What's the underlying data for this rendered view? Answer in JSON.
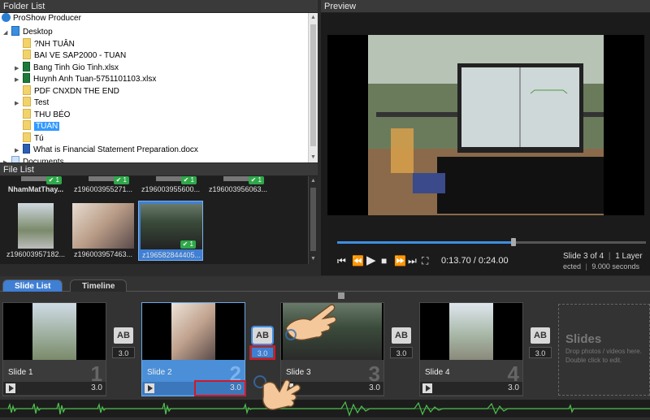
{
  "folder_list": {
    "title": "Folder List",
    "root": "ProShow Producer",
    "items": [
      {
        "label": "Desktop",
        "type": "desktop",
        "indent": 1,
        "arrow": "expanded"
      },
      {
        "label": "?NH TUÂN",
        "type": "folder",
        "indent": 2,
        "arrow": ""
      },
      {
        "label": "BAI VE SAP2000 - TUAN",
        "type": "folder",
        "indent": 2,
        "arrow": ""
      },
      {
        "label": "Bang Tinh Gio Tinh.xlsx",
        "type": "xls",
        "indent": 2,
        "arrow": "collapsed"
      },
      {
        "label": "Huynh Anh Tuan-5751101103.xlsx",
        "type": "xls",
        "indent": 2,
        "arrow": "collapsed"
      },
      {
        "label": "PDF CNXDN THE END",
        "type": "pdf",
        "indent": 2,
        "arrow": ""
      },
      {
        "label": "Test",
        "type": "folder",
        "indent": 2,
        "arrow": "collapsed"
      },
      {
        "label": "THU BÉO",
        "type": "folder",
        "indent": 2,
        "arrow": ""
      },
      {
        "label": "TUAN",
        "type": "folder",
        "indent": 2,
        "arrow": "",
        "selected": true
      },
      {
        "label": "Tú",
        "type": "folder",
        "indent": 2,
        "arrow": ""
      },
      {
        "label": "What is Financial Statement Preparation.docx",
        "type": "doc",
        "indent": 2,
        "arrow": "collapsed"
      },
      {
        "label": "Documents",
        "type": "docs",
        "indent": 1,
        "arrow": "collapsed"
      }
    ]
  },
  "file_list": {
    "title": "File List",
    "row1": [
      {
        "name": "NhamMatThay...",
        "checked": true,
        "count": "1"
      },
      {
        "name": "z196003955271...",
        "checked": true,
        "count": "1"
      },
      {
        "name": "z196003955600...",
        "checked": true,
        "count": "1"
      },
      {
        "name": "z196003956063...",
        "checked": true,
        "count": "1"
      }
    ],
    "row2": [
      {
        "name": "z196003957182...",
        "checked": false,
        "count": ""
      },
      {
        "name": "z196003957463...",
        "checked": false,
        "count": ""
      },
      {
        "name": "z196582844405...",
        "checked": true,
        "count": "1",
        "selected": true
      }
    ]
  },
  "preview": {
    "title": "Preview",
    "time": "0:13.70 / 0:24.00",
    "progress_fraction": 0.57,
    "slide_info": "Slide 3 of 4",
    "layers": "1 Layer",
    "selected": "ected",
    "seconds": "9.000 seconds"
  },
  "tabs": {
    "slide_list": "Slide List",
    "timeline": "Timeline"
  },
  "slides": [
    {
      "name": "Slide 1",
      "num": "1",
      "dur": "3.0",
      "trans": "3.0",
      "selected": false
    },
    {
      "name": "Slide 2",
      "num": "2",
      "dur": "3.0",
      "trans": "3.0",
      "selected": true
    },
    {
      "name": "Slide 3",
      "num": "3",
      "dur": "3.0",
      "trans": "3.0",
      "selected": false
    },
    {
      "name": "Slide 4",
      "num": "4",
      "dur": "3.0",
      "trans": "3.0",
      "selected": false
    }
  ],
  "transition_icon": "AB",
  "drop_zone": {
    "title": "Slides",
    "line1": "Drop photos / videos here.",
    "line2": "Double click to edit."
  },
  "colors": {
    "accent": "#3e8ee0",
    "selection": "#3399ff",
    "highlight_box": "#d01a2a"
  }
}
